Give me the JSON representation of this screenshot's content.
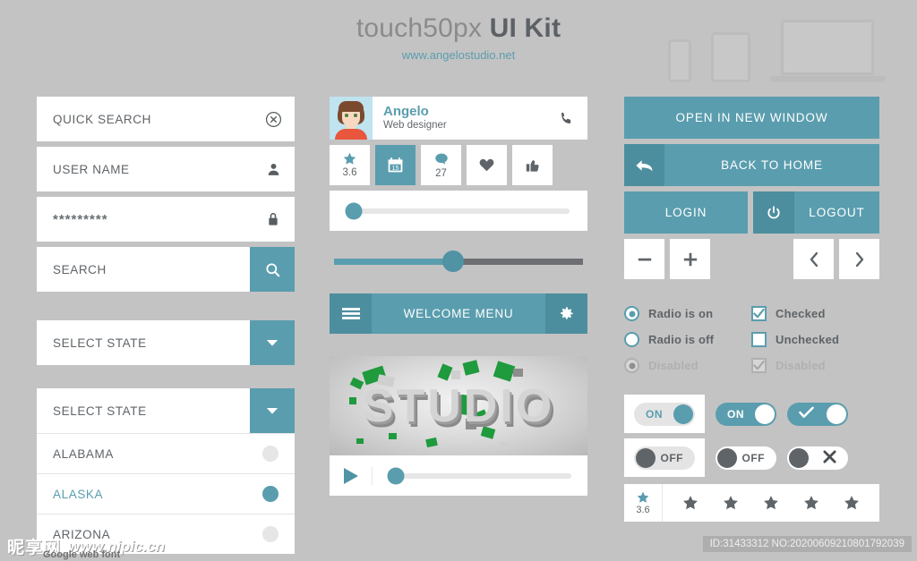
{
  "header": {
    "title_light": "touch50px ",
    "title_bold": "UI Kit",
    "subtitle": "www.angelostudio.net",
    "devices": [
      "phone-outline",
      "tablet-outline",
      "laptop-outline"
    ]
  },
  "column1": {
    "fields": [
      {
        "label": "QUICK SEARCH",
        "icon": "clear-circle-icon",
        "type": "text"
      },
      {
        "label": "USER NAME",
        "icon": "user-icon",
        "type": "text"
      },
      {
        "label": "*********",
        "icon": "lock-icon",
        "type": "password"
      },
      {
        "label": "SEARCH",
        "icon": "search-icon",
        "type": "search-button"
      }
    ],
    "select_closed": {
      "label": "SELECT STATE",
      "icon": "chevron-down-icon"
    },
    "select_open": {
      "label": "SELECT STATE",
      "icon": "chevron-down-icon",
      "options": [
        {
          "label": "ALABAMA",
          "selected": false
        },
        {
          "label": "ALASKA",
          "selected": true
        },
        {
          "label": "ARIZONA",
          "selected": false
        }
      ]
    }
  },
  "column2": {
    "profile": {
      "name": "Angelo",
      "role": "Web designer",
      "call_icon": "phone-icon",
      "avatar": "avatar-illustration"
    },
    "stats": [
      {
        "icon": "star-icon",
        "value": "3.6",
        "active": false
      },
      {
        "icon": "calendar-icon",
        "value": "15",
        "active": true
      },
      {
        "icon": "comment-icon",
        "value": "27",
        "active": false
      },
      {
        "icon": "heart-icon",
        "value": "",
        "active": false
      },
      {
        "icon": "thumbs-up-icon",
        "value": "",
        "active": false
      }
    ],
    "slider_card": {
      "value_pct": 3
    },
    "slider_bare": {
      "value_pct": 48
    },
    "menubar": {
      "left_icon": "hamburger-icon",
      "label": "WELCOME MENU",
      "right_icon": "gear-icon"
    },
    "video": {
      "poster_text": "STUDIO",
      "play_icon": "play-icon",
      "progress_pct": 4
    }
  },
  "column3": {
    "buttons": {
      "open_new_window": "OPEN IN NEW WINDOW",
      "back_to_home": "BACK TO HOME",
      "back_icon": "back-arrow-icon",
      "login": "LOGIN",
      "logout": "LOGOUT",
      "power_icon": "power-icon",
      "minus": "−",
      "plus": "+",
      "prev": "‹",
      "next": "›"
    },
    "radios": [
      {
        "label": "Radio is on",
        "state": "on"
      },
      {
        "label": "Radio is off",
        "state": "off"
      },
      {
        "label": "Disabled",
        "state": "disabled"
      }
    ],
    "checkboxes": [
      {
        "label": "Checked",
        "state": "checked"
      },
      {
        "label": "Unchecked",
        "state": "unchecked"
      },
      {
        "label": "Disabled",
        "state": "disabled"
      }
    ],
    "toggles": [
      {
        "style": "boxed-light",
        "on_label": "ON",
        "off_label": "OFF"
      },
      {
        "style": "filled",
        "on_label": "ON",
        "off_label": "OFF"
      },
      {
        "style": "icon",
        "on_label": "check-icon",
        "off_label": "cross-icon"
      }
    ],
    "rating": {
      "score": "3.6",
      "score_icon": "star-icon",
      "stars": 5
    }
  },
  "footer": {
    "watermark_cn": "昵享网",
    "watermark_url": "www.nipic.cn",
    "watermark_sub": "Google web font",
    "id_text": "ID:31433312 NO:20200609210801792039"
  },
  "colors": {
    "accent": "#5a9dae",
    "accent_dark": "#4d8e9e",
    "background": "#c3c3c3",
    "text": "#5f6468",
    "card": "#ffffff"
  }
}
